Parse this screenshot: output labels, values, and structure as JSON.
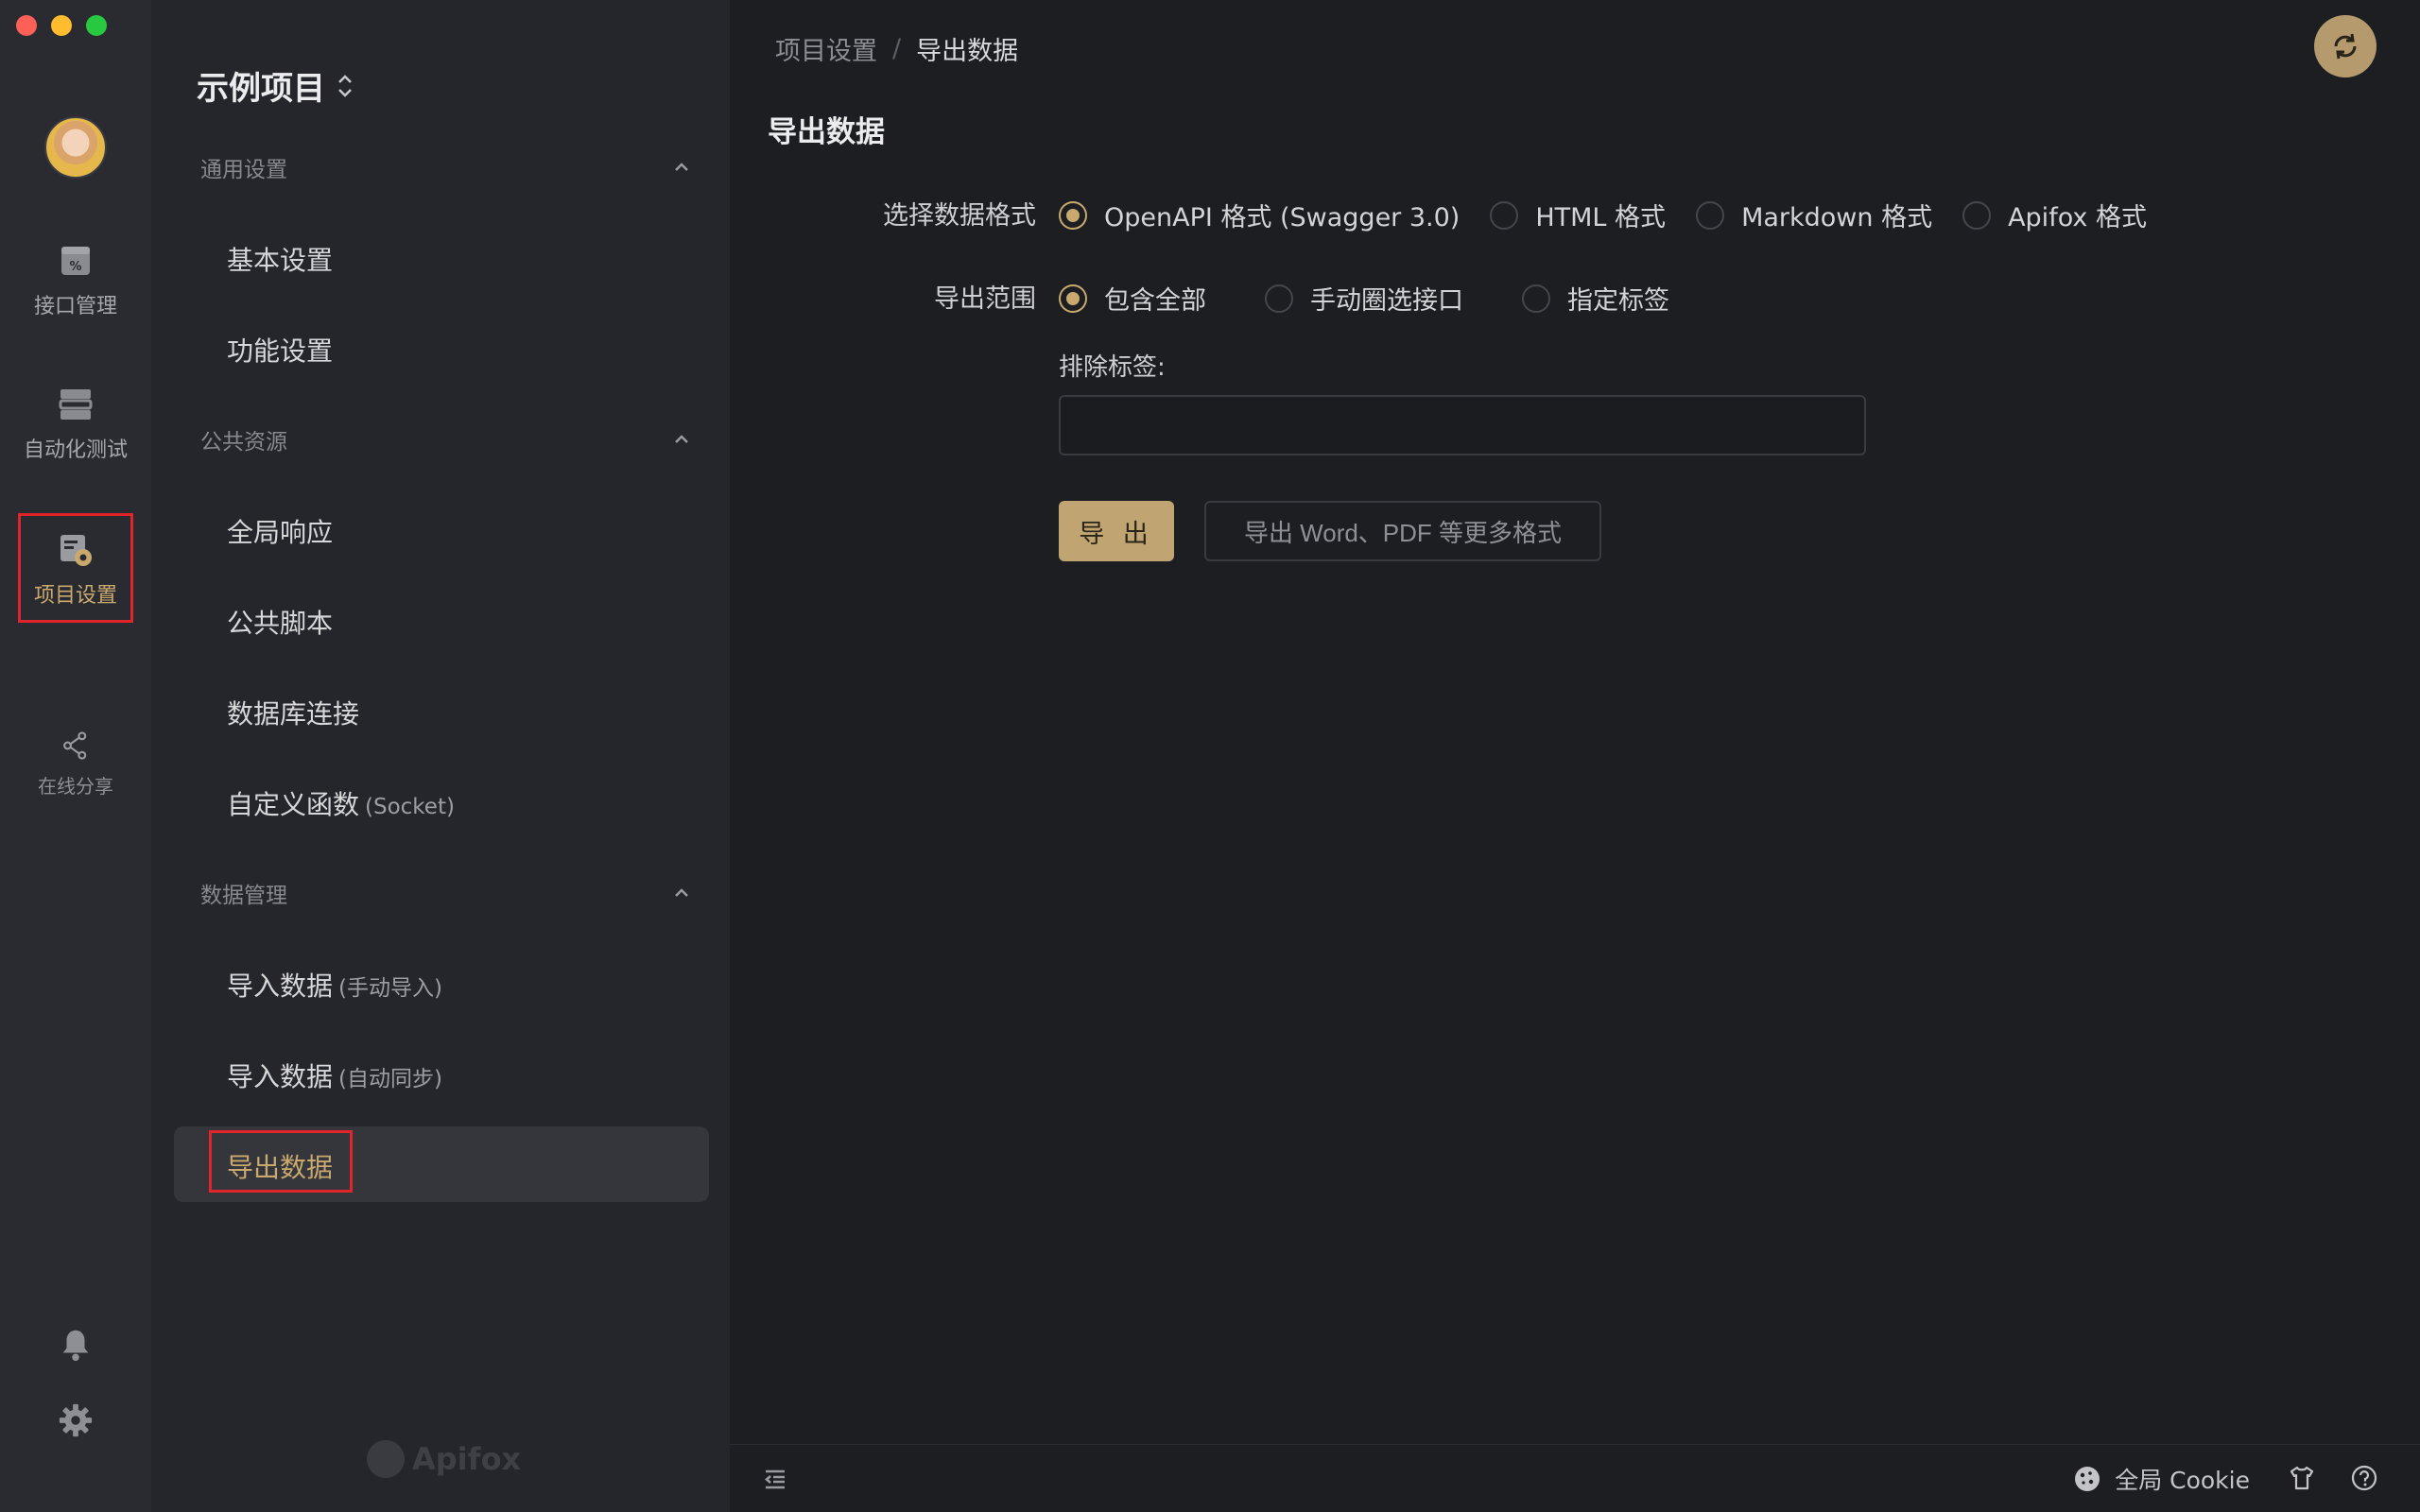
{
  "window": {
    "traffic_lights": [
      "close",
      "minimize",
      "zoom"
    ]
  },
  "rail": {
    "items": [
      {
        "label": "接口管理",
        "icon": "api-management-icon"
      },
      {
        "label": "自动化测试",
        "icon": "automated-test-icon"
      },
      {
        "label": "项目设置",
        "icon": "project-settings-icon",
        "active": true
      },
      {
        "label": "在线分享",
        "icon": "share-icon"
      }
    ],
    "bottom_icons": [
      "bell-icon",
      "gear-icon"
    ]
  },
  "sidebar": {
    "project_name": "示例项目",
    "switch_glyph": "⌃⌄",
    "sections": [
      {
        "title": "通用设置",
        "items": [
          {
            "label": "基本设置"
          },
          {
            "label": "功能设置"
          }
        ]
      },
      {
        "title": "公共资源",
        "items": [
          {
            "label": "全局响应"
          },
          {
            "label": "公共脚本"
          },
          {
            "label": "数据库连接"
          },
          {
            "label": "自定义函数",
            "sub": "(Socket)"
          }
        ]
      },
      {
        "title": "数据管理",
        "items": [
          {
            "label": "导入数据",
            "sub": "(手动导入)"
          },
          {
            "label": "导入数据",
            "sub": "(自动同步)"
          },
          {
            "label": "导出数据",
            "active": true
          }
        ]
      }
    ],
    "logo_text": "Apifox"
  },
  "main": {
    "breadcrumb": {
      "parent": "项目设置",
      "separator": "/",
      "current": "导出数据"
    },
    "title": "导出数据",
    "format": {
      "label": "选择数据格式",
      "options": [
        "OpenAPI 格式 (Swagger 3.0)",
        "HTML 格式",
        "Markdown 格式",
        "Apifox 格式"
      ],
      "selected": "OpenAPI 格式 (Swagger 3.0)"
    },
    "scope": {
      "label": "导出范围",
      "options": [
        "包含全部",
        "手动圈选接口",
        "指定标签"
      ],
      "selected": "包含全部"
    },
    "exclude_tags": {
      "label": "排除标签:",
      "value": "",
      "placeholder": ""
    },
    "buttons": {
      "export": "导 出",
      "more_formats": "导出 Word、PDF 等更多格式"
    }
  },
  "bottom_bar": {
    "cookie_label": "全局 Cookie"
  },
  "colors": {
    "accent": "#c9a96e",
    "highlight_box": "#e0242b",
    "background": "#1d1e22",
    "sidebar": "#25262b",
    "rail": "#2a2b31"
  }
}
